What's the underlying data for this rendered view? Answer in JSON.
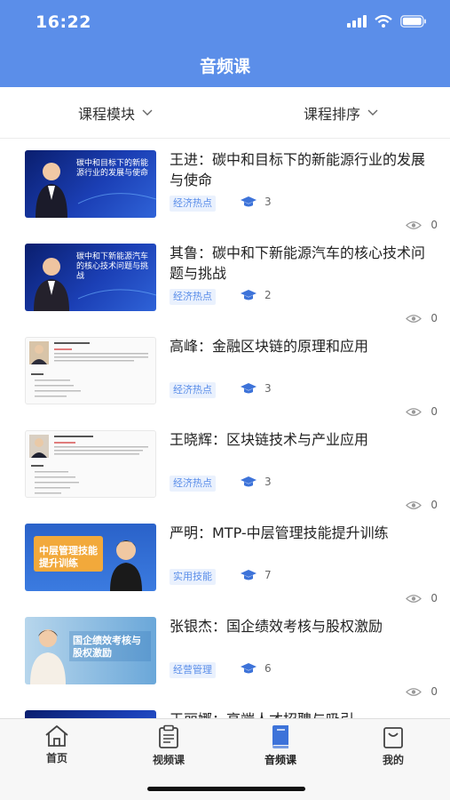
{
  "status_bar": {
    "time": "16:22"
  },
  "header": {
    "title": "音频课"
  },
  "filters": {
    "module_label": "课程模块",
    "sort_label": "课程排序"
  },
  "courses": [
    {
      "title": "王进：碳中和目标下的新能源行业的发展与使命",
      "tag": "经济热点",
      "learners": "3",
      "views": "0",
      "thumb_text": "碳中和目标下的新能源行业的发展与使命"
    },
    {
      "title": "其鲁：碳中和下新能源汽车的核心技术问题与挑战",
      "tag": "经济热点",
      "learners": "2",
      "views": "0",
      "thumb_text": "碳中和下新能源汽车的核心技术问题与挑战"
    },
    {
      "title": "高峰：金融区块链的原理和应用",
      "tag": "经济热点",
      "learners": "3",
      "views": "0"
    },
    {
      "title": "王晓辉：区块链技术与产业应用",
      "tag": "经济热点",
      "learners": "3",
      "views": "0"
    },
    {
      "title": "严明：MTP-中层管理技能提升训练",
      "tag": "实用技能",
      "learners": "7",
      "views": "0",
      "thumb_text": "中层管理技能提升训练"
    },
    {
      "title": "张银杰：国企绩效考核与股权激励",
      "tag": "经营管理",
      "learners": "6",
      "views": "0",
      "thumb_text": "国企绩效考核与股权激励"
    },
    {
      "title": "王丽娜：高端人才招聘与吸引"
    }
  ],
  "tabs": [
    {
      "label": "首页",
      "icon": "home-icon"
    },
    {
      "label": "视频课",
      "icon": "clipboard-icon"
    },
    {
      "label": "音频课",
      "icon": "book-icon"
    },
    {
      "label": "我的",
      "icon": "bag-icon"
    }
  ],
  "colors": {
    "accent": "#5b8ee9",
    "tag_bg": "#eaf1fd"
  }
}
